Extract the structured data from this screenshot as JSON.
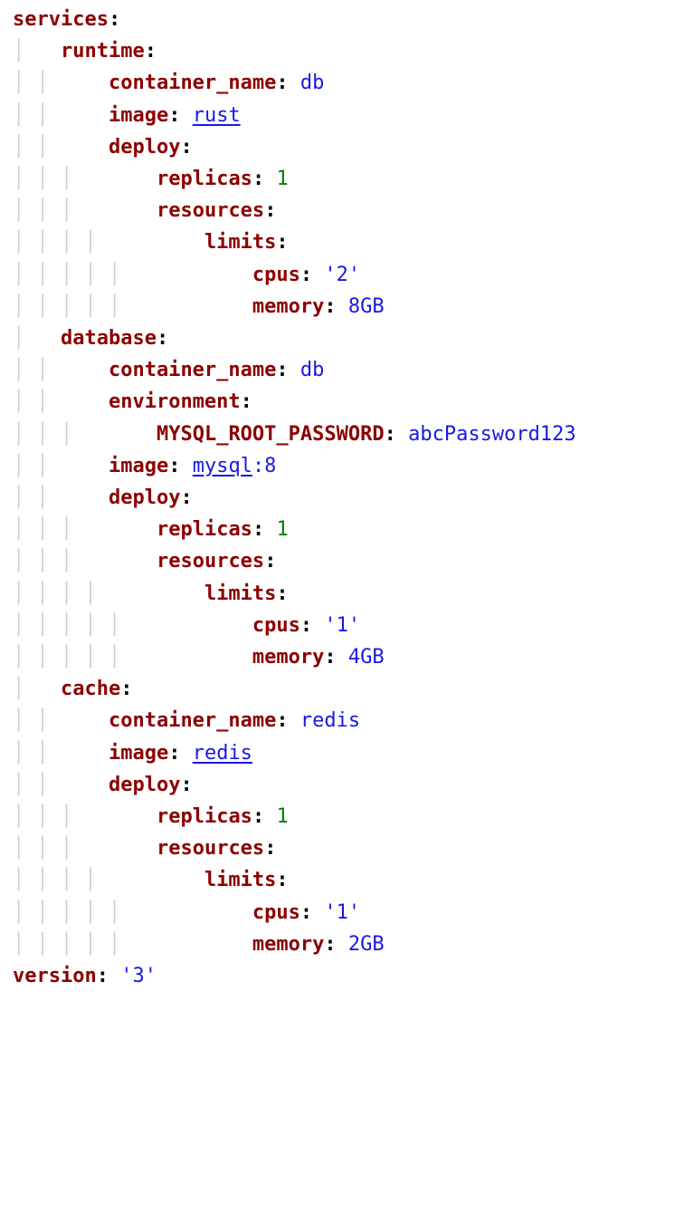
{
  "yaml": {
    "services_key": "services",
    "runtime": {
      "name": "runtime",
      "container_name_key": "container_name",
      "container_name_val": "db",
      "image_key": "image",
      "image_link": "rust",
      "image_suffix": "",
      "deploy_key": "deploy",
      "replicas_key": "replicas",
      "replicas_val": "1",
      "resources_key": "resources",
      "limits_key": "limits",
      "cpus_key": "cpus",
      "cpus_val": "'2'",
      "memory_key": "memory",
      "memory_val": "8GB"
    },
    "database": {
      "name": "database",
      "container_name_key": "container_name",
      "container_name_val": "db",
      "environment_key": "environment",
      "env_pw_key": "MYSQL_ROOT_PASSWORD",
      "env_pw_val": "abcPassword123",
      "image_key": "image",
      "image_link": "mysql",
      "image_suffix": ":8",
      "deploy_key": "deploy",
      "replicas_key": "replicas",
      "replicas_val": "1",
      "resources_key": "resources",
      "limits_key": "limits",
      "cpus_key": "cpus",
      "cpus_val": "'1'",
      "memory_key": "memory",
      "memory_val": "4GB"
    },
    "cache": {
      "name": "cache",
      "container_name_key": "container_name",
      "container_name_val": "redis",
      "image_key": "image",
      "image_link": "redis",
      "image_suffix": "",
      "deploy_key": "deploy",
      "replicas_key": "replicas",
      "replicas_val": "1",
      "resources_key": "resources",
      "limits_key": "limits",
      "cpus_key": "cpus",
      "cpus_val": "'1'",
      "memory_key": "memory",
      "memory_val": "2GB"
    },
    "version_key": "version",
    "version_val": "'3'"
  }
}
